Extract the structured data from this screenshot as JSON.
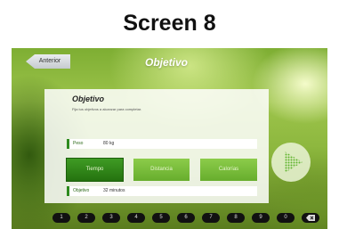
{
  "screen_title": "Screen 8",
  "header": {
    "back_label": "Anterior",
    "title": "Objetivo"
  },
  "panel": {
    "heading": "Objetivo",
    "subtitle": "Fija tus objetivos a alcanzar para completar."
  },
  "fields": {
    "peso": {
      "label": "Peso",
      "value": "80 kg"
    },
    "objetivo": {
      "label": "Objetivo",
      "value": "32 minutos"
    }
  },
  "tabs": [
    {
      "label": "Tiempo",
      "selected": true
    },
    {
      "label": "Distancia",
      "selected": false
    },
    {
      "label": "Calorías",
      "selected": false
    }
  ],
  "play_icon": "play-icon",
  "keypad": {
    "keys": [
      "1",
      "2",
      "3",
      "4",
      "5",
      "6",
      "7",
      "8",
      "9",
      "0"
    ],
    "backspace_icon": "backspace-icon"
  },
  "colors": {
    "accent_green": "#2e8b1e",
    "selected_tab": "#24720f",
    "tab": "#7bbd3c"
  }
}
